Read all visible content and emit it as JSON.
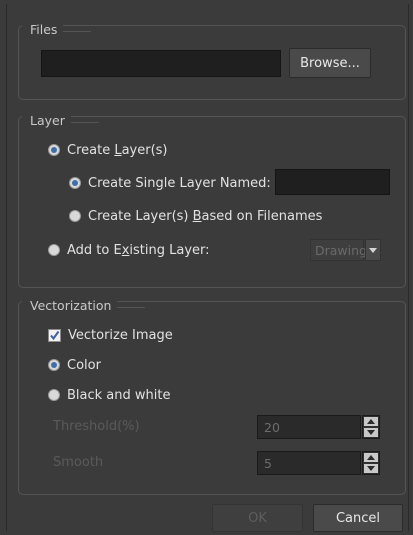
{
  "files": {
    "title": "Files",
    "path_value": "",
    "browse_label": "Browse..."
  },
  "layer": {
    "title": "Layer",
    "create_layers": {
      "label_pre": "Create ",
      "label_u": "L",
      "label_post": "ayer(s)",
      "checked": true
    },
    "create_single": {
      "label_pre": "Create Sin",
      "label_u": "g",
      "label_post": "le Layer Named:",
      "checked": true,
      "value": ""
    },
    "create_based": {
      "label_pre": "Create Layer(s) ",
      "label_u": "B",
      "label_post": "ased on Filenames",
      "checked": false
    },
    "add_existing": {
      "label_pre": "Add to E",
      "label_u": "x",
      "label_post": "isting Layer:",
      "checked": false,
      "selected": "Drawing"
    }
  },
  "vectorization": {
    "title": "Vectorization",
    "vectorize": {
      "label": "Vectorize Image",
      "checked": true
    },
    "color": {
      "label": "Color",
      "checked": true
    },
    "bw": {
      "label": "Black and white",
      "checked": false
    },
    "threshold": {
      "label": "Threshold(%)",
      "value": "20"
    },
    "smooth": {
      "label": "Smooth",
      "value": "5"
    }
  },
  "footer": {
    "ok_label": "OK",
    "cancel_label": "Cancel"
  },
  "colors": {
    "background": "#3b3b3b",
    "radio_dot": "#3d6ea8",
    "check": "#3d5fa0"
  }
}
